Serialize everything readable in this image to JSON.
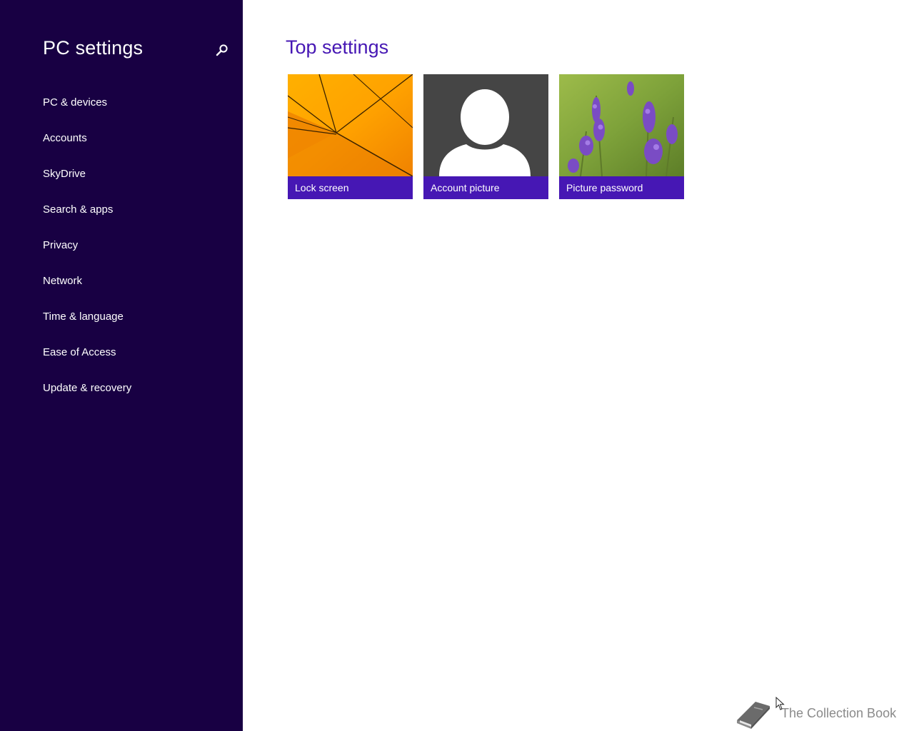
{
  "sidebar": {
    "title": "PC settings",
    "search_icon": "search-icon",
    "items": [
      {
        "label": "PC & devices"
      },
      {
        "label": "Accounts"
      },
      {
        "label": "SkyDrive"
      },
      {
        "label": "Search & apps"
      },
      {
        "label": "Privacy"
      },
      {
        "label": "Network"
      },
      {
        "label": "Time & language"
      },
      {
        "label": "Ease of Access"
      },
      {
        "label": "Update & recovery"
      }
    ]
  },
  "main": {
    "title": "Top settings",
    "tiles": [
      {
        "label": "Lock screen",
        "image": "orange-lines-wallpaper"
      },
      {
        "label": "Account picture",
        "image": "default-user-silhouette"
      },
      {
        "label": "Picture password",
        "image": "lavender-flowers-photo"
      }
    ]
  },
  "watermark": {
    "text": "The Collection Book",
    "icon": "book-icon"
  },
  "colors": {
    "sidebar_bg": "#180043",
    "accent": "#4617b4",
    "background": "#ffffff"
  }
}
